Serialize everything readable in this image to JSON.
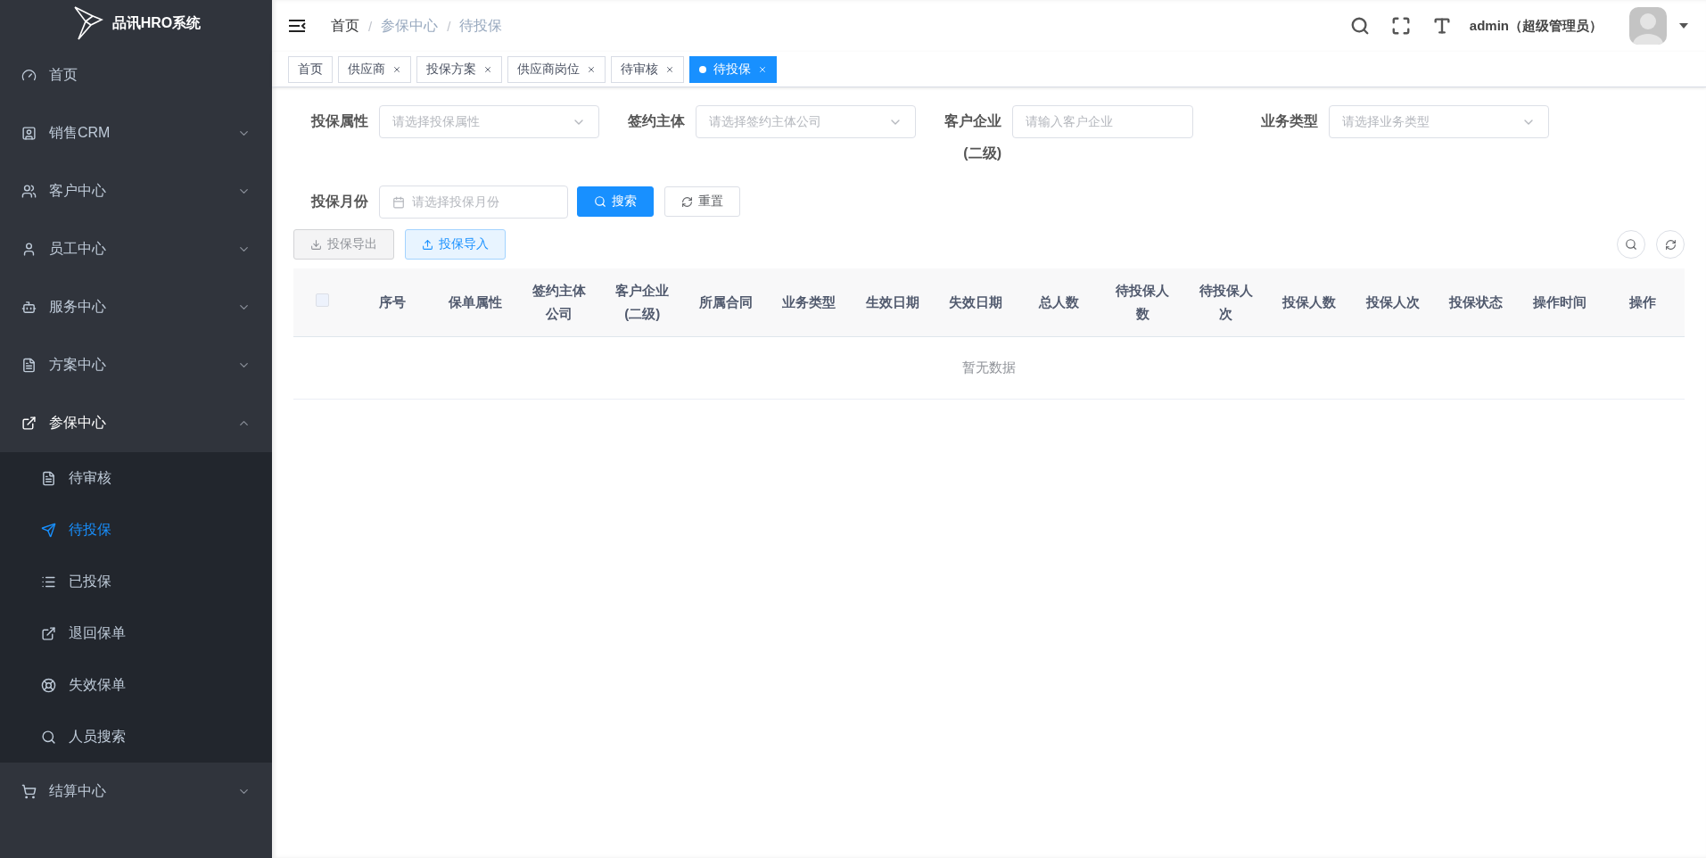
{
  "sidebar": {
    "title": "品讯HRO系统",
    "items": [
      {
        "label": "首页",
        "kind": "link",
        "expanded": false
      },
      {
        "label": "销售CRM",
        "kind": "submenu",
        "expanded": false
      },
      {
        "label": "客户中心",
        "kind": "submenu",
        "expanded": false
      },
      {
        "label": "员工中心",
        "kind": "submenu",
        "expanded": false
      },
      {
        "label": "服务中心",
        "kind": "submenu",
        "expanded": false
      },
      {
        "label": "方案中心",
        "kind": "submenu",
        "expanded": false
      },
      {
        "label": "参保中心",
        "kind": "submenu",
        "expanded": true,
        "children": [
          {
            "label": "待审核",
            "selected": false
          },
          {
            "label": "待投保",
            "selected": true
          },
          {
            "label": "已投保",
            "selected": false
          },
          {
            "label": "退回保单",
            "selected": false
          },
          {
            "label": "失效保单",
            "selected": false
          },
          {
            "label": "人员搜索",
            "selected": false
          }
        ]
      },
      {
        "label": "结算中心",
        "kind": "submenu",
        "expanded": false
      }
    ]
  },
  "breadcrumb": [
    {
      "label": "首页",
      "kind": "link"
    },
    {
      "label": "/",
      "kind": "separator"
    },
    {
      "label": "参保中心",
      "kind": "text"
    },
    {
      "label": "/",
      "kind": "separator"
    },
    {
      "label": "待投保",
      "kind": "text"
    }
  ],
  "user": {
    "name": "admin（超级管理员）"
  },
  "tabs": [
    {
      "label": "首页",
      "selected": false,
      "closable": false
    },
    {
      "label": "供应商",
      "selected": false,
      "closable": true
    },
    {
      "label": "投保方案",
      "selected": false,
      "closable": true
    },
    {
      "label": "供应商岗位",
      "selected": false,
      "closable": true
    },
    {
      "label": "待审核",
      "selected": false,
      "closable": true
    },
    {
      "label": "待投保",
      "selected": true,
      "closable": true
    }
  ],
  "filters": [
    {
      "label": "投保属性",
      "placeholder": "请选择投保属性",
      "kind": "select"
    },
    {
      "label": "签约主体",
      "placeholder": "请选择签约主体公司",
      "kind": "select"
    },
    {
      "label": "客户企业(二级)",
      "placeholder": "请输入客户企业",
      "kind": "input"
    },
    {
      "label": "业务类型",
      "placeholder": "请选择业务类型",
      "kind": "select"
    },
    {
      "label": "投保月份",
      "placeholder": "请选择投保月份",
      "kind": "date"
    }
  ],
  "search_button": "搜索",
  "reset_button": "重置",
  "toolbar": [
    {
      "label": "投保导出",
      "kind": "export"
    },
    {
      "label": "投保导入",
      "kind": "import"
    }
  ],
  "table": {
    "select_all": {
      "checked": false
    },
    "columns": [
      "序号",
      "保单属性",
      "签约主体公司",
      "客户企业(二级)",
      "所属合同",
      "业务类型",
      "生效日期",
      "失效日期",
      "总人数",
      "待投保人数",
      "待投保人次",
      "投保人数",
      "投保人次",
      "投保状态",
      "操作时间",
      "操作"
    ],
    "empty_text": "暂无数据"
  }
}
